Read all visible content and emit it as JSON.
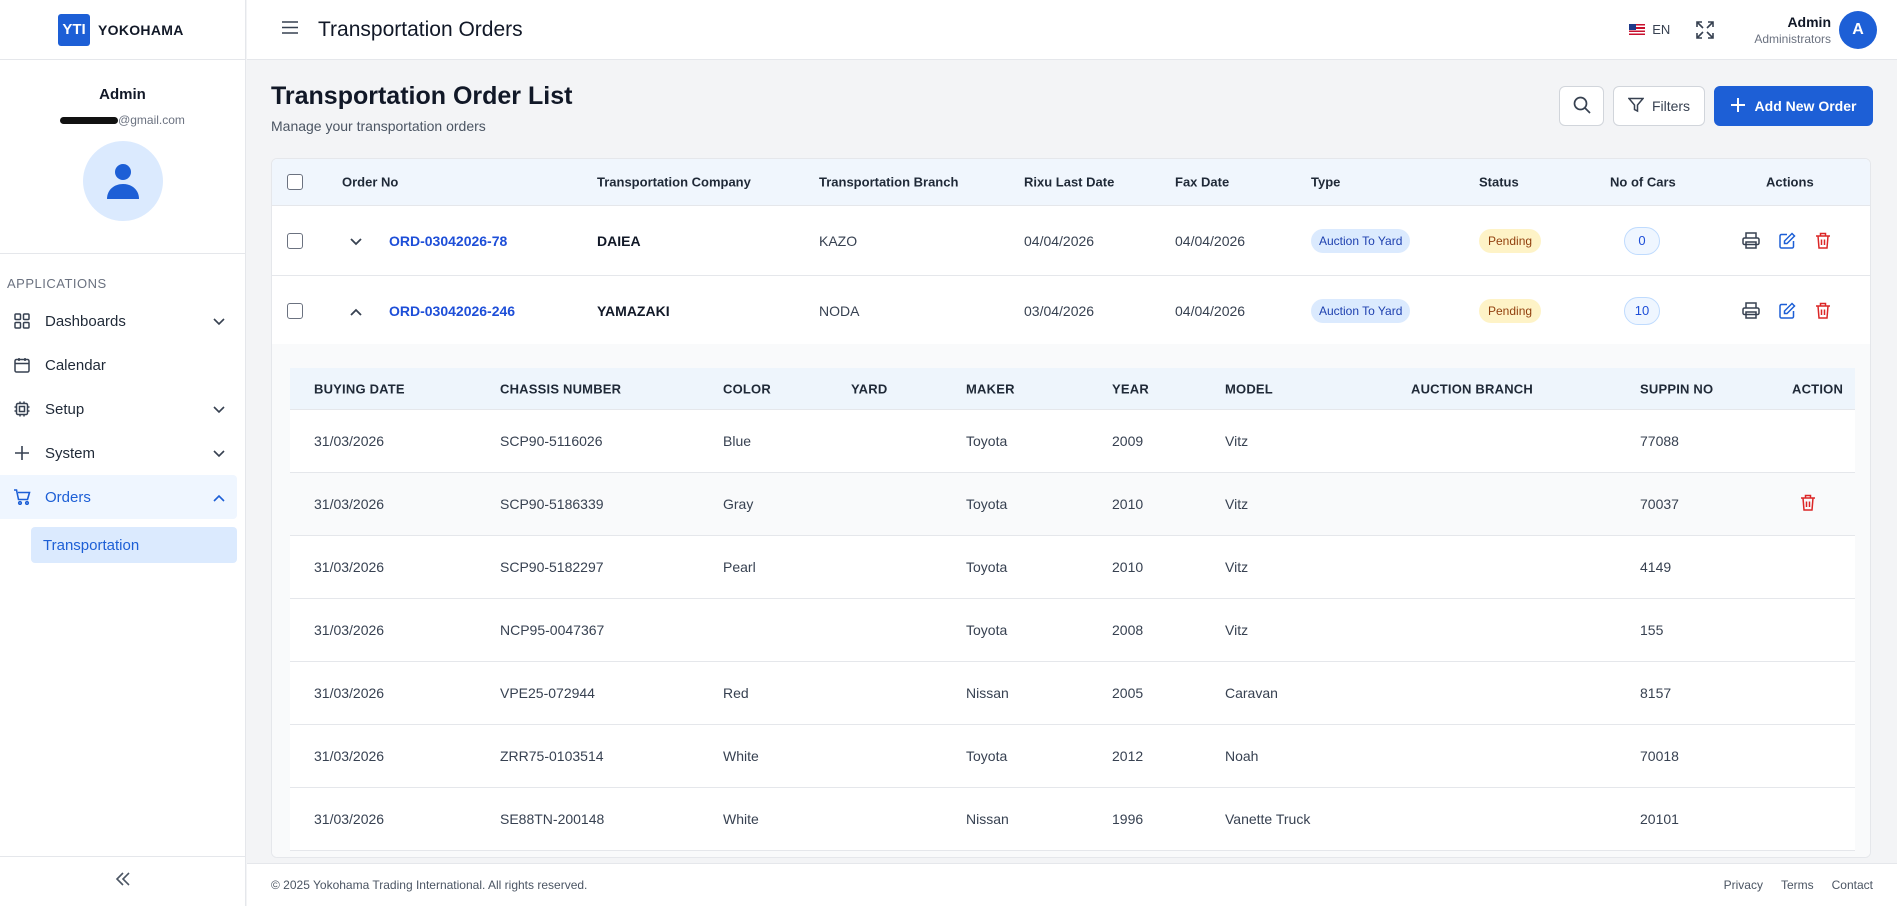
{
  "sidebar": {
    "logo_mark": "YTI",
    "logo_text": "YOKOHAMA",
    "profile_name": "Admin",
    "profile_email_suffix": "@gmail.com",
    "section_label": "APPLICATIONS",
    "items": [
      {
        "label": "Dashboards",
        "icon": "grid-icon",
        "expandable": true
      },
      {
        "label": "Calendar",
        "icon": "calendar-icon",
        "expandable": false
      },
      {
        "label": "Setup",
        "icon": "cpu-icon",
        "expandable": true
      },
      {
        "label": "System",
        "icon": "plus-icon",
        "expandable": true
      },
      {
        "label": "Orders",
        "icon": "cart-icon",
        "expandable": true,
        "active": true
      }
    ],
    "sub_item": "Transportation"
  },
  "header": {
    "title": "Transportation Orders",
    "language": "EN",
    "user_name": "Admin",
    "user_role": "Administrators",
    "user_initial": "A"
  },
  "page": {
    "title": "Transportation Order List",
    "subtitle": "Manage your transportation orders",
    "filters_label": "Filters",
    "add_label": "Add New Order"
  },
  "orders_table": {
    "columns": [
      "Order No",
      "Transportation Company",
      "Transportation Branch",
      "Rixu Last Date",
      "Fax Date",
      "Type",
      "Status",
      "No of Cars",
      "Actions"
    ],
    "rows": [
      {
        "order_no": "ORD-03042026-78",
        "company": "DAIEA",
        "branch": "KAZO",
        "rixu_date": "04/04/2026",
        "fax_date": "04/04/2026",
        "type": "Auction To Yard",
        "status": "Pending",
        "cars": "0",
        "expanded": false
      },
      {
        "order_no": "ORD-03042026-246",
        "company": "YAMAZAKI",
        "branch": "NODA",
        "rixu_date": "03/04/2026",
        "fax_date": "04/04/2026",
        "type": "Auction To Yard",
        "status": "Pending",
        "cars": "10",
        "expanded": true
      }
    ]
  },
  "cars_table": {
    "columns": [
      "BUYING DATE",
      "CHASSIS NUMBER",
      "COLOR",
      "YARD",
      "MAKER",
      "YEAR",
      "MODEL",
      "AUCTION BRANCH",
      "SUPPIN NO",
      "ACTION"
    ],
    "rows": [
      {
        "buying_date": "31/03/2026",
        "chassis": "SCP90-5116026",
        "color": "Blue",
        "yard": "",
        "maker": "Toyota",
        "year": "2009",
        "model": "Vitz",
        "auction_branch": "",
        "suppin": "77088"
      },
      {
        "buying_date": "31/03/2026",
        "chassis": "SCP90-5186339",
        "color": "Gray",
        "yard": "",
        "maker": "Toyota",
        "year": "2010",
        "model": "Vitz",
        "auction_branch": "",
        "suppin": "70037"
      },
      {
        "buying_date": "31/03/2026",
        "chassis": "SCP90-5182297",
        "color": "Pearl",
        "yard": "",
        "maker": "Toyota",
        "year": "2010",
        "model": "Vitz",
        "auction_branch": "",
        "suppin": "4149"
      },
      {
        "buying_date": "31/03/2026",
        "chassis": "NCP95-0047367",
        "color": "",
        "yard": "",
        "maker": "Toyota",
        "year": "2008",
        "model": "Vitz",
        "auction_branch": "",
        "suppin": "155"
      },
      {
        "buying_date": "31/03/2026",
        "chassis": "VPE25-072944",
        "color": "Red",
        "yard": "",
        "maker": "Nissan",
        "year": "2005",
        "model": "Caravan",
        "auction_branch": "",
        "suppin": "8157"
      },
      {
        "buying_date": "31/03/2026",
        "chassis": "ZRR75-0103514",
        "color": "White",
        "yard": "",
        "maker": "Toyota",
        "year": "2012",
        "model": "Noah",
        "auction_branch": "",
        "suppin": "70018"
      },
      {
        "buying_date": "31/03/2026",
        "chassis": "SE88TN-200148",
        "color": "White",
        "yard": "",
        "maker": "Nissan",
        "year": "1996",
        "model": "Vanette Truck",
        "auction_branch": "",
        "suppin": "20101"
      }
    ]
  },
  "footer": {
    "copyright": "© 2025 Yokohama Trading International. All rights reserved.",
    "links": [
      "Privacy",
      "Terms",
      "Contact"
    ]
  },
  "colors": {
    "primary": "#1d5fd6",
    "danger": "#dc2626",
    "pending_bg": "#fef3c7",
    "type_bg": "#dbeafe"
  }
}
